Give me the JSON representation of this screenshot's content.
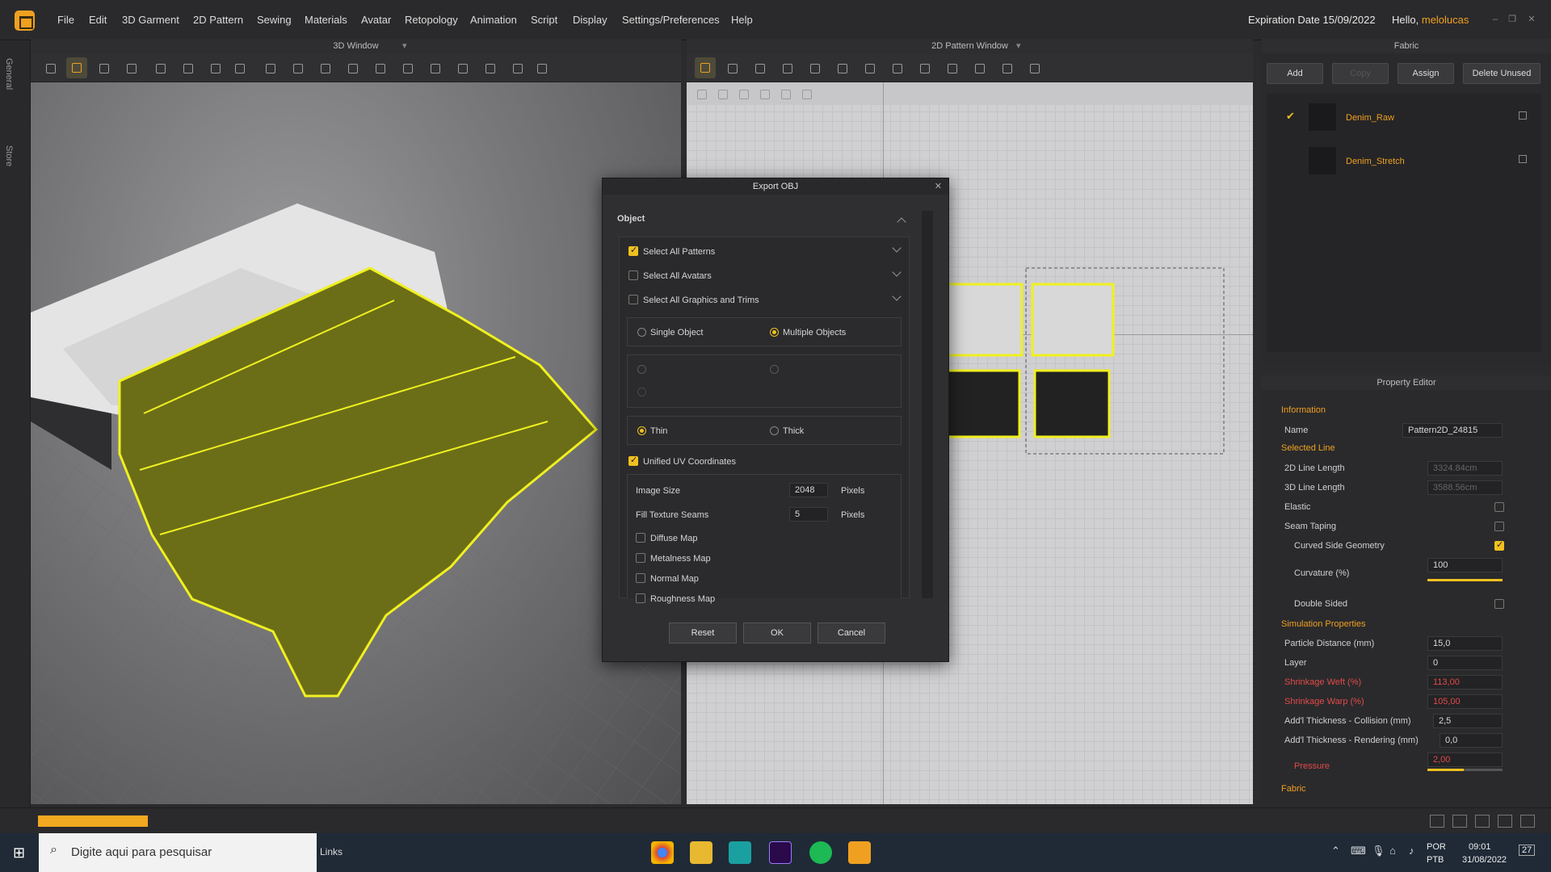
{
  "menu": {
    "items": [
      "File",
      "Edit",
      "3D Garment",
      "2D Pattern",
      "Sewing",
      "Materials",
      "Avatar",
      "Retopology",
      "Animation",
      "Script",
      "Display",
      "Settings/Preferences",
      "Help"
    ],
    "expiration": "Expiration Date 15/09/2022",
    "hello_prefix": "Hello, ",
    "username": "melolucas"
  },
  "left_tabs": [
    "General",
    "Store"
  ],
  "panels": {
    "window3d_title": "3D Window",
    "window2d_title": "2D Pattern Window",
    "fabric_title": "Fabric",
    "property_title": "Property Editor"
  },
  "fabric": {
    "buttons": {
      "add": "Add",
      "copy": "Copy",
      "assign": "Assign",
      "delete_unused": "Delete Unused"
    },
    "items": [
      {
        "name": "Denim_Raw",
        "selected": true
      },
      {
        "name": "Denim_Stretch",
        "selected": false
      }
    ]
  },
  "property_editor": {
    "information": "Information",
    "name_label": "Name",
    "name_value": "Pattern2D_24815",
    "selected_line": "Selected Line",
    "line2d_label": "2D Line Length",
    "line2d_value": "3324.84cm",
    "line3d_label": "3D Line Length",
    "line3d_value": "3588.56cm",
    "elastic_label": "Elastic",
    "seam_taping_label": "Seam Taping",
    "curved_label": "Curved Side Geometry",
    "curvature_label": "Curvature (%)",
    "curvature_value": "100",
    "curvature_slider": 1.0,
    "double_sided_label": "Double Sided",
    "sim_props": "Simulation Properties",
    "particle_label": "Particle Distance (mm)",
    "particle_value": "15,0",
    "layer_label": "Layer",
    "layer_value": "0",
    "weft_label": "Shrinkage Weft (%)",
    "weft_value": "113,00",
    "warp_label": "Shrinkage Warp (%)",
    "warp_value": "105,00",
    "collision_label": "Add'l Thickness - Collision (mm)",
    "collision_value": "2,5",
    "rendering_label": "Add'l Thickness - Rendering (mm)",
    "rendering_value": "0,0",
    "pressure_label": "Pressure",
    "pressure_value": "2,00",
    "fabric_label": "Fabric"
  },
  "dialog": {
    "title": "Export OBJ",
    "section": "Object",
    "select_all_patterns": "Select All Patterns",
    "select_all_avatars": "Select All Avatars",
    "select_all_graphics": "Select All Graphics and Trims",
    "single_object": "Single Object",
    "multiple_objects": "Multiple Objects",
    "thin": "Thin",
    "thick": "Thick",
    "unified_uv": "Unified UV Coordinates",
    "image_size_label": "Image Size",
    "image_size_value": "2048",
    "pixels": "Pixels",
    "fill_seams_label": "Fill Texture Seams",
    "fill_seams_value": "5",
    "diffuse": "Diffuse Map",
    "metalness": "Metalness Map",
    "normal": "Normal Map",
    "roughness": "Roughness Map",
    "reset": "Reset",
    "ok": "OK",
    "cancel": "Cancel"
  },
  "taskbar": {
    "search_placeholder": "Digite aqui para pesquisar",
    "links": "Links",
    "lang1": "POR",
    "lang2": "PTB",
    "time": "09:01",
    "date": "31/08/2022",
    "notif": "27"
  },
  "colors": {
    "accent": "#f0a020",
    "highlight": "#f0e020",
    "error": "#e24a4a"
  }
}
